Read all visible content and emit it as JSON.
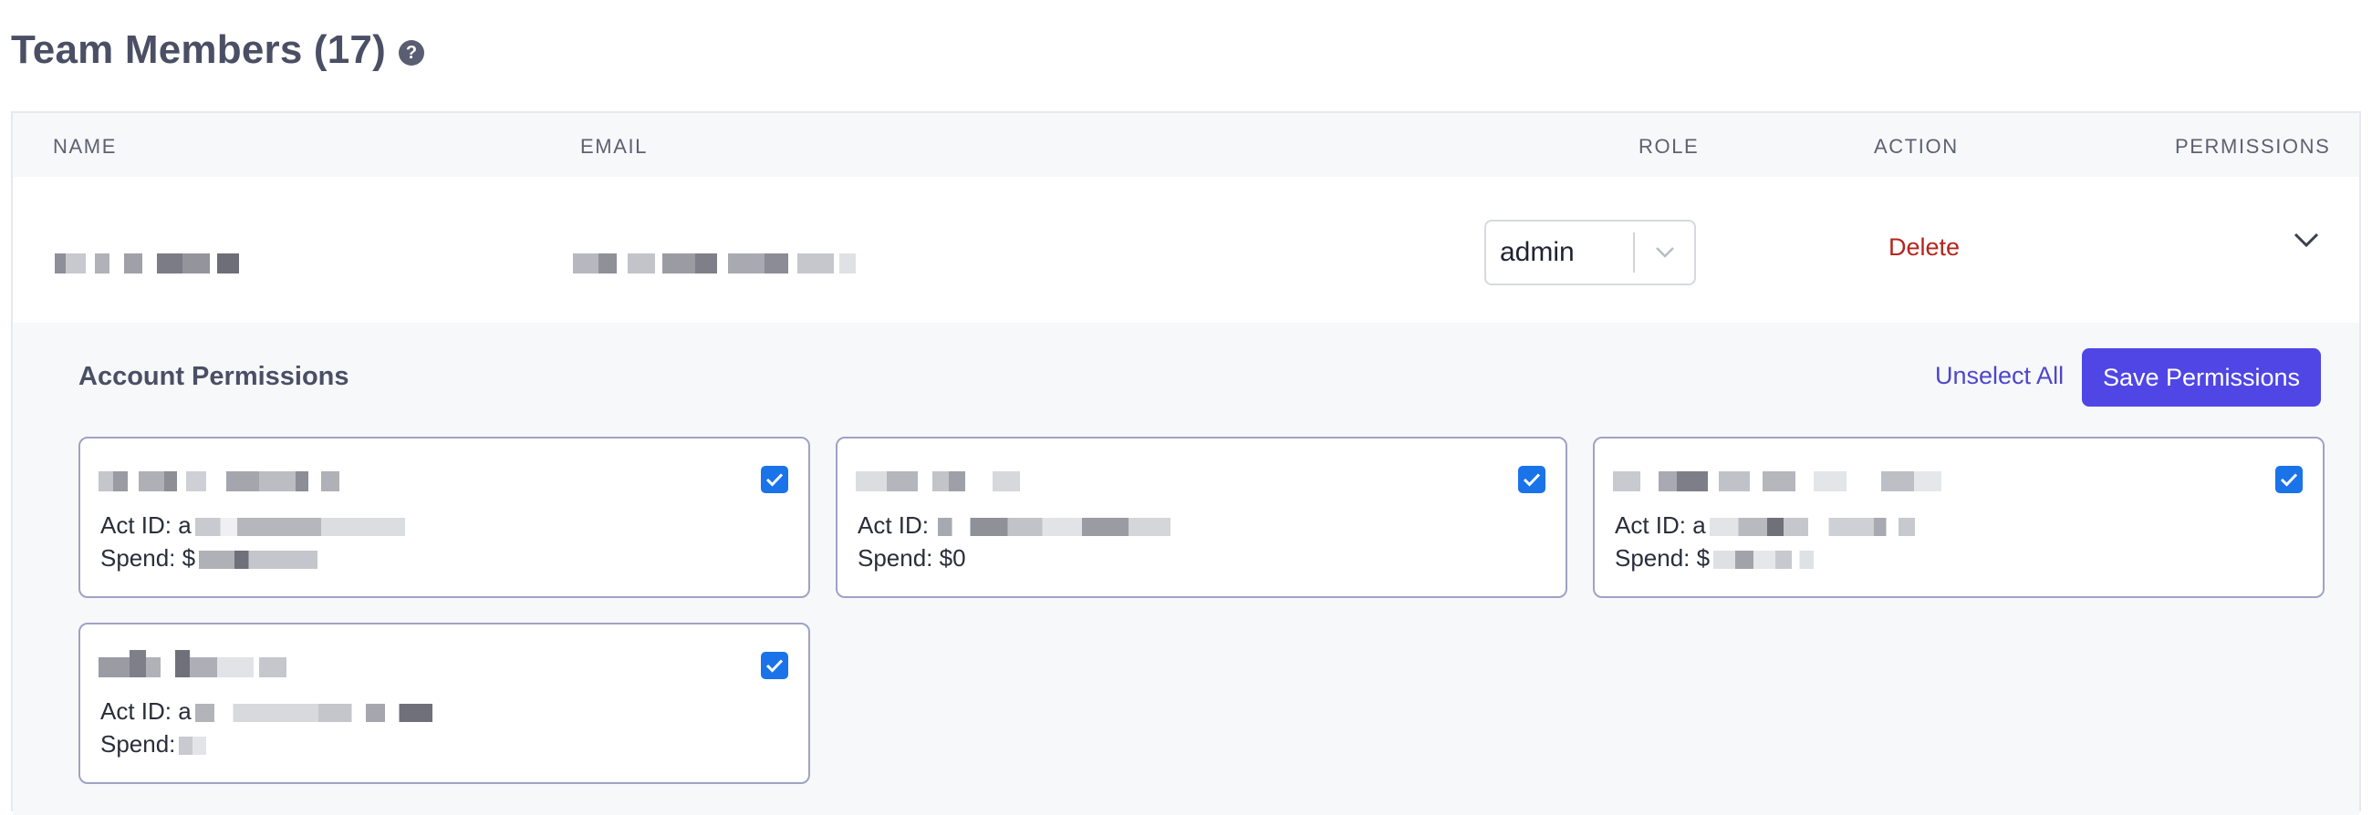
{
  "page": {
    "title": "Team Members (17)"
  },
  "table": {
    "headers": {
      "name": "NAME",
      "email": "EMAIL",
      "role": "ROLE",
      "action": "ACTION",
      "permissions": "PERMISSIONS"
    },
    "row": {
      "role": "admin",
      "action": "Delete"
    }
  },
  "permissions": {
    "title": "Account Permissions",
    "unselect_label": "Unselect All",
    "save_label": "Save Permissions",
    "accounts": [
      {
        "act_prefix": "Act ID: a",
        "spend_prefix": "Spend: $",
        "checked": true
      },
      {
        "act_prefix": "Act ID:",
        "spend_prefix": "Spend: $0",
        "checked": true
      },
      {
        "act_prefix": "Act ID: a",
        "spend_prefix": "Spend: $",
        "checked": true
      },
      {
        "act_prefix": "Act ID: a",
        "spend_prefix": "Spend:",
        "checked": true
      }
    ]
  },
  "colors": {
    "accent": "#4f46e5",
    "danger": "#b3261e",
    "checkbox": "#1a73e8",
    "card_border": "#9ea3c4"
  }
}
